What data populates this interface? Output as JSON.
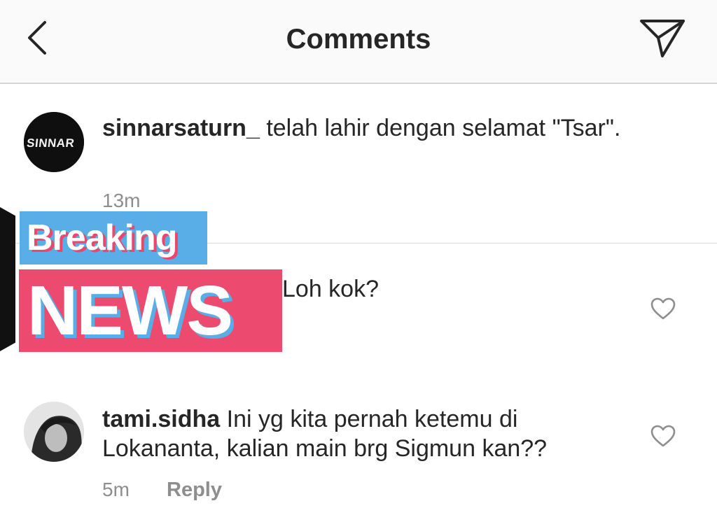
{
  "header": {
    "title": "Comments",
    "back_icon": "chevron-left-icon",
    "send_icon": "paper-plane-icon"
  },
  "caption": {
    "username": "sinnarsaturn_",
    "avatar_logo": "SINNAR",
    "text": "telah lahir dengan selamat \"Tsar\".",
    "time": "13m"
  },
  "comments": [
    {
      "username": "",
      "text": "Loh kok?",
      "sticker": {
        "line1": "Breaking",
        "line2": "NEWS"
      }
    },
    {
      "username": "tami.sidha",
      "text": "Ini yg kita pernah ketemu di Lokananta, kalian main brg Sigmun kan??",
      "time": "5m",
      "reply_label": "Reply"
    }
  ],
  "colors": {
    "sticker_blue": "#5aaee8",
    "sticker_pink": "#ec4a6e",
    "meta_gray": "#8e8e8e"
  }
}
